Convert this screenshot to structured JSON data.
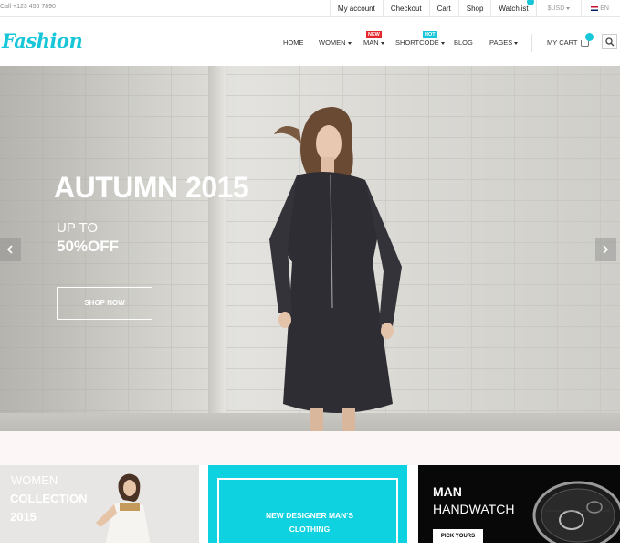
{
  "topbar": {
    "phone": "Call +123 456 7890",
    "links": [
      "My account",
      "Checkout",
      "Cart",
      "Shop",
      "Watchlist"
    ],
    "currency": "$USD",
    "language": "EN"
  },
  "nav": {
    "logo": "Fashion",
    "menu": [
      "HOME",
      "WOMEN",
      "MAN",
      "SHORTCODE",
      "BLOG",
      "PAGES"
    ],
    "badge_new": "NEW",
    "badge_hot": "HOT",
    "cart_label": "MY CART"
  },
  "hero": {
    "title": "AUTUMN 2015",
    "subtitle_1": "UP TO",
    "subtitle_2": "50%OFF",
    "button": "SHOP NOW"
  },
  "banners": {
    "women": {
      "line1": "WOMEN",
      "line2": "COLLECTION",
      "line3": "2015"
    },
    "designer": {
      "line1": "NEW DESIGNER MAN'S",
      "line2": "CLOTHING"
    },
    "watch": {
      "line1": "MAN",
      "line2": "HANDWATCH",
      "button": "PICK YOURS"
    }
  },
  "colors": {
    "accent": "#17c6d8",
    "badge_new": "#e5262c",
    "banner_cyan": "#0fd2e1"
  }
}
